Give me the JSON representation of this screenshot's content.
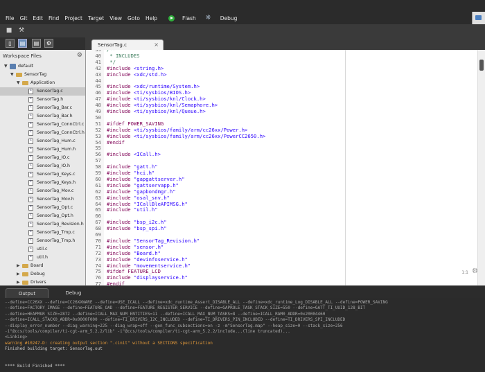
{
  "menu": [
    "File",
    "Git",
    "Edit",
    "Find",
    "Project",
    "Target",
    "View",
    "Goto",
    "Help"
  ],
  "toolbar": {
    "flash_label": "Flash",
    "debug_label": "Debug"
  },
  "workspace": {
    "title": "Workspace Files",
    "tree": [
      {
        "label": "default",
        "level": 0,
        "type": "project",
        "expanded": true
      },
      {
        "label": "SensorTag",
        "level": 1,
        "type": "folder",
        "expanded": true
      },
      {
        "label": "Application",
        "level": 2,
        "type": "folder",
        "expanded": true
      },
      {
        "label": "SensorTag.c",
        "level": 3,
        "type": "file",
        "selected": true
      },
      {
        "label": "SensorTag.h",
        "level": 3,
        "type": "file"
      },
      {
        "label": "SensorTag_Bar.c",
        "level": 3,
        "type": "file"
      },
      {
        "label": "SensorTag_Bar.h",
        "level": 3,
        "type": "file"
      },
      {
        "label": "SensorTag_ConnCtrl.c",
        "level": 3,
        "type": "file"
      },
      {
        "label": "SensorTag_ConnCtrl.h",
        "level": 3,
        "type": "file"
      },
      {
        "label": "SensorTag_Hum.c",
        "level": 3,
        "type": "file"
      },
      {
        "label": "SensorTag_Hum.h",
        "level": 3,
        "type": "file"
      },
      {
        "label": "SensorTag_IO.c",
        "level": 3,
        "type": "file"
      },
      {
        "label": "SensorTag_IO.h",
        "level": 3,
        "type": "file"
      },
      {
        "label": "SensorTag_Keys.c",
        "level": 3,
        "type": "file"
      },
      {
        "label": "SensorTag_Keys.h",
        "level": 3,
        "type": "file"
      },
      {
        "label": "SensorTag_Mov.c",
        "level": 3,
        "type": "file"
      },
      {
        "label": "SensorTag_Mov.h",
        "level": 3,
        "type": "file"
      },
      {
        "label": "SensorTag_Opt.c",
        "level": 3,
        "type": "file"
      },
      {
        "label": "SensorTag_Opt.h",
        "level": 3,
        "type": "file"
      },
      {
        "label": "SensorTag_Revision.h",
        "level": 3,
        "type": "file"
      },
      {
        "label": "SensorTag_Tmp.c",
        "level": 3,
        "type": "file"
      },
      {
        "label": "SensorTag_Tmp.h",
        "level": 3,
        "type": "file"
      },
      {
        "label": "util.c",
        "level": 3,
        "type": "file"
      },
      {
        "label": "util.h",
        "level": 3,
        "type": "file"
      },
      {
        "label": "Board",
        "level": 2,
        "type": "folder",
        "expanded": false
      },
      {
        "label": "Debug",
        "level": 2,
        "type": "folder",
        "expanded": false
      },
      {
        "label": "Drivers",
        "level": 2,
        "type": "folder",
        "expanded": false
      }
    ]
  },
  "editor": {
    "tab_label": "SensorTag.c",
    "zoom": "1:1",
    "lines": [
      {
        "n": "40",
        "t": " * INCLUDES",
        "k": "cm"
      },
      {
        "n": "41",
        "t": " */",
        "k": "cm"
      },
      {
        "n": "42",
        "t": "#include <string.h>",
        "k": "inc"
      },
      {
        "n": "43",
        "t": "#include <xdc/std.h>",
        "k": "inc"
      },
      {
        "n": "44",
        "t": "",
        "k": "plain"
      },
      {
        "n": "45",
        "t": "#include <xdc/runtime/System.h>",
        "k": "inc"
      },
      {
        "n": "46",
        "t": "#include <ti/sysbios/BIOS.h>",
        "k": "inc"
      },
      {
        "n": "47",
        "t": "#include <ti/sysbios/knl/Clock.h>",
        "k": "inc"
      },
      {
        "n": "48",
        "t": "#include <ti/sysbios/knl/Semaphore.h>",
        "k": "inc"
      },
      {
        "n": "49",
        "t": "#include <ti/sysbios/knl/Queue.h>",
        "k": "inc"
      },
      {
        "n": "50",
        "t": "",
        "k": "plain"
      },
      {
        "n": "51",
        "t": "#ifdef POWER_SAVING",
        "k": "pp"
      },
      {
        "n": "52",
        "t": "#include <ti/sysbios/family/arm/cc26xx/Power.h>",
        "k": "inc"
      },
      {
        "n": "53",
        "t": "#include <ti/sysbios/family/arm/cc26xx/PowerCC2650.h>",
        "k": "inc"
      },
      {
        "n": "54",
        "t": "#endif",
        "k": "pp"
      },
      {
        "n": "55",
        "t": "",
        "k": "plain"
      },
      {
        "n": "56",
        "t": "#include <ICall.h>",
        "k": "inc"
      },
      {
        "n": "57",
        "t": "",
        "k": "plain"
      },
      {
        "n": "58",
        "t": "#include \"gatt.h\"",
        "k": "inc"
      },
      {
        "n": "59",
        "t": "#include \"hci.h\"",
        "k": "inc"
      },
      {
        "n": "60",
        "t": "#include \"gapgattserver.h\"",
        "k": "inc"
      },
      {
        "n": "61",
        "t": "#include \"gattservapp.h\"",
        "k": "inc"
      },
      {
        "n": "62",
        "t": "#include \"gapbondmgr.h\"",
        "k": "inc"
      },
      {
        "n": "63",
        "t": "#include \"osal_snv.h\"",
        "k": "inc"
      },
      {
        "n": "64",
        "t": "#include \"ICallBleAPIMSG.h\"",
        "k": "inc"
      },
      {
        "n": "65",
        "t": "#include \"util.h\"",
        "k": "inc"
      },
      {
        "n": "66",
        "t": "",
        "k": "plain"
      },
      {
        "n": "67",
        "t": "#include \"bsp_i2c.h\"",
        "k": "inc"
      },
      {
        "n": "68",
        "t": "#include \"bsp_spi.h\"",
        "k": "inc"
      },
      {
        "n": "69",
        "t": "",
        "k": "plain"
      },
      {
        "n": "70",
        "t": "#include \"SensorTag_Revision.h\"",
        "k": "inc"
      },
      {
        "n": "71",
        "t": "#include \"sensor.h\"",
        "k": "inc"
      },
      {
        "n": "72",
        "t": "#include \"Board.h\"",
        "k": "inc"
      },
      {
        "n": "73",
        "t": "#include \"devinfoservice.h\"",
        "k": "inc"
      },
      {
        "n": "74",
        "t": "#include \"movementservice.h\"",
        "k": "inc"
      },
      {
        "n": "75",
        "t": "#ifdef FEATURE_LCD",
        "k": "pp"
      },
      {
        "n": "76",
        "t": "#include \"displayservice.h\"",
        "k": "inc"
      },
      {
        "n": "77",
        "t": "#endif",
        "k": "pp"
      }
    ]
  },
  "output": {
    "tabs": [
      "Output",
      "Debug"
    ],
    "lines": [
      {
        "t": "--define=CC26XX --define=CC26XXWARE --define=USE_ICALL --define=xdc_runtime_Assert_DISABLE_ALL --define=xdc_runtime_Log_DISABLE_ALL --define=POWER_SAVING",
        "k": "dim"
      },
      {
        "t": "--define=FACTORY_IMAGE --define=FEATURE_OAD --define=FEATURE_REGISTER_SERVICE --define=GAPROLE_TASK_STACK_SIZE=550 --define=GATT_TI_UUID_128_BIT",
        "k": "dim"
      },
      {
        "t": "--define=HEAPMGR_SIZE=2872 --define=ICALL_MAX_NUM_ENTITIES=11 --define=ICALL_MAX_NUM_TASKS=8 --define=ICALL_RAM0_ADDR=0x20004460",
        "k": "dim"
      },
      {
        "t": "--define=ICALL_STACK0_ADDR=0x0000F000 --define=TI_DRIVERS_I2C_INCLUDED --define=TI_DRIVERS_PIN_INCLUDED --define=TI_DRIVERS_SPI_INCLUDED",
        "k": "dim"
      },
      {
        "t": "--display_error_number --diag_warning=225 --diag_wrap=off --gen_func_subsections=on -z -m\"SensorTag.map\" --heap_size=0 --stack_size=256",
        "k": "dim"
      },
      {
        "t": "-i\"@ccs/tools/compiler/ti-cgt-arm_5.2.2/lib\" -i\"@ccs/tools/compiler/ti-cgt-arm_5.2.2/include...(line truncated)...",
        "k": "dim"
      },
      {
        "t": "<Linking>",
        "k": "dim"
      },
      {
        "t": "warning #10247-D: creating output section \".cinit\" without a SECTIONS specification",
        "k": "warn"
      },
      {
        "t": "Finished building target: SensorTag.out",
        "k": "norm"
      },
      {
        "t": "",
        "k": "norm"
      },
      {
        "t": "",
        "k": "norm"
      },
      {
        "t": "**** Build Finished ****",
        "k": "norm"
      }
    ]
  }
}
